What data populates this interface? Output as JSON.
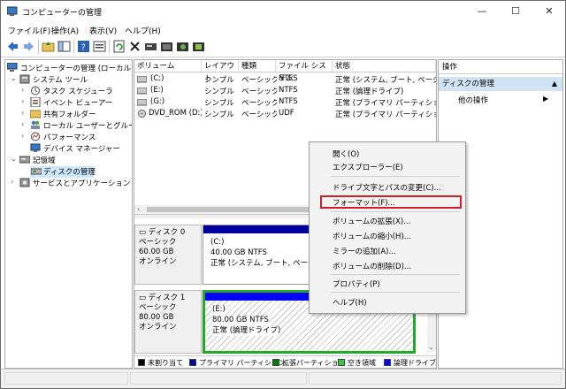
{
  "window": {
    "title": "コンピューターの管理",
    "buttons": {
      "minimize": "—",
      "maximize": "☐",
      "close": "✕"
    }
  },
  "menu": [
    {
      "label": "ファイル(F)"
    },
    {
      "label": "操作(A)"
    },
    {
      "label": "表示(V)"
    },
    {
      "label": "ヘルプ(H)"
    }
  ],
  "toolbar": {
    "icons": [
      "back-icon",
      "forward-icon",
      "up-folder-icon",
      "show-tree-icon",
      "help-icon",
      "properties-icon",
      "refresh-icon",
      "delete-icon",
      "disk-icon",
      "open-icon",
      "search-icon",
      "settings-icon"
    ]
  },
  "tree": {
    "root": "コンピューターの管理 (ローカル)",
    "system_tools": "システム ツール",
    "task_scheduler": "タスク スケジューラ",
    "event_viewer": "イベント ビューアー",
    "shared_folders": "共有フォルダー",
    "local_users": "ローカル ユーザーとグループ",
    "performance": "パフォーマンス",
    "device_manager": "デバイス マネージャー",
    "storage": "記憶域",
    "disk_management": "ディスクの管理",
    "services": "サービスとアプリケーション"
  },
  "volume_list": {
    "headers": {
      "volume": "ボリューム",
      "layout": "レイアウト",
      "type": "種類",
      "filesystem": "ファイル システム",
      "status": "状態"
    },
    "rows": [
      {
        "volume": "(C:)",
        "layout": "シンプル",
        "type": "ベーシック",
        "fs": "NTFS",
        "status": "正常 (システム, ブート, ページ ファ"
      },
      {
        "volume": "(E:)",
        "layout": "シンプル",
        "type": "ベーシック",
        "fs": "NTFS",
        "status": "正常 (論理ドライブ)"
      },
      {
        "volume": "(G:)",
        "layout": "シンプル",
        "type": "ベーシック",
        "fs": "NTFS",
        "status": "正常 (プライマリ パーティション)"
      },
      {
        "volume": "DVD_ROM (D:)",
        "layout": "シンプル",
        "type": "ベーシック",
        "fs": "UDF",
        "status": "正常 (プライマリ パーティション)"
      }
    ]
  },
  "disks": [
    {
      "name": "ディスク 0",
      "kind": "ベーシック",
      "size": "60.00 GB",
      "state": "オンライン",
      "partition": {
        "letter": "(C:)",
        "size_fs": "40.00 GB NTFS",
        "status": "正常 (システム, ブート, ページ ファ"
      }
    },
    {
      "name": "ディスク 1",
      "kind": "ベーシック",
      "size": "80.00 GB",
      "state": "オンライン",
      "partition": {
        "letter": "(E:)",
        "size_fs": "80.00 GB NTFS",
        "status": "正常 (論理ドライブ)"
      }
    }
  ],
  "legend": [
    {
      "label": "未割り当て",
      "color": "#000000"
    },
    {
      "label": "プライマリ パーティション",
      "color": "#0000a0"
    },
    {
      "label": "拡張パーティション",
      "color": "#008000"
    },
    {
      "label": "空き領域",
      "color": "#33cc33"
    },
    {
      "label": "論理ドライブ",
      "color": "#0000ff"
    }
  ],
  "actions": {
    "header": "操作",
    "section": "ディスクの管理",
    "item": "他の操作"
  },
  "context_menu": {
    "open": "開く(O)",
    "explorer": "エクスプローラー(E)",
    "change_letter": "ドライブ文字とパスの変更(C)...",
    "format": "フォーマット(F)...",
    "extend": "ボリュームの拡張(X)...",
    "shrink": "ボリュームの縮小(H)...",
    "add_mirror": "ミラーの追加(A)...",
    "delete": "ボリュームの削除(D)...",
    "properties": "プロパティ(P)",
    "help": "ヘルプ(H)"
  },
  "colors": {
    "highlight_box": "#d0202a",
    "selection": "#cce8ff",
    "action_section": "#cfe3f5"
  }
}
